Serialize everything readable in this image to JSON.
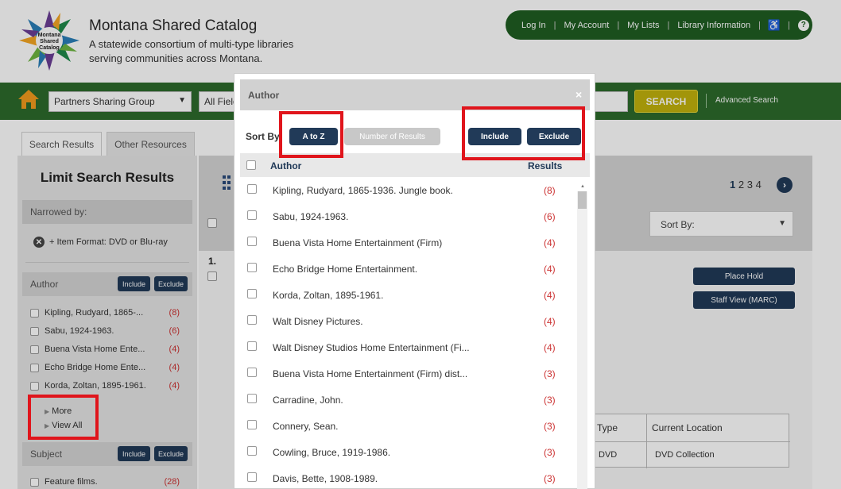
{
  "header": {
    "title": "Montana Shared Catalog",
    "subtitle": "A statewide consortium of multi-type libraries serving communities across Montana.",
    "logo_text": "Montana Shared Catalog",
    "nav": [
      "Log In",
      "My Account",
      "My Lists",
      "Library Information"
    ],
    "help": "?"
  },
  "search": {
    "group": "Partners Sharing Group",
    "field": "All Fields",
    "button": "SEARCH",
    "advanced": "Advanced Search"
  },
  "tabs": [
    "Search Results",
    "Other Resources"
  ],
  "sidebar": {
    "title": "Limit Search Results",
    "narrowed_label": "Narrowed by:",
    "active_filter": "+ Item Format: DVD or Blu-ray",
    "author_facet": {
      "label": "Author",
      "include": "Include",
      "exclude": "Exclude",
      "items": [
        {
          "name": "Kipling, Rudyard, 1865-...",
          "count": "(8)"
        },
        {
          "name": "Sabu, 1924-1963.",
          "count": "(6)"
        },
        {
          "name": "Buena Vista Home Ente...",
          "count": "(4)"
        },
        {
          "name": "Echo Bridge Home Ente...",
          "count": "(4)"
        },
        {
          "name": "Korda, Zoltan, 1895-1961.",
          "count": "(4)"
        }
      ],
      "more": "More",
      "view_all": "View All"
    },
    "subject_facet": {
      "label": "Subject",
      "include": "Include",
      "exclude": "Exclude",
      "items": [
        {
          "name": "Feature films.",
          "count": "(28)"
        }
      ]
    }
  },
  "results": {
    "pages": [
      "1",
      "2",
      "3",
      "4"
    ],
    "next": "›",
    "sort_label": "Sort By:",
    "first_number": "1.",
    "place_hold": "Place Hold",
    "staff_view": "Staff View (MARC)",
    "holdings_headers": [
      "Type",
      "Current Location"
    ],
    "holdings_row": [
      "DVD",
      "DVD Collection"
    ]
  },
  "modal": {
    "title": "Author",
    "close": "×",
    "sort_by": "Sort By",
    "sort_az": "A to Z",
    "sort_count": "Number of Results",
    "include": "Include",
    "exclude": "Exclude",
    "col_author": "Author",
    "col_results": "Results",
    "items": [
      {
        "name": "Kipling, Rudyard, 1865-1936. Jungle book.",
        "count": "(8)"
      },
      {
        "name": "Sabu, 1924-1963.",
        "count": "(6)"
      },
      {
        "name": "Buena Vista Home Entertainment (Firm)",
        "count": "(4)"
      },
      {
        "name": "Echo Bridge Home Entertainment.",
        "count": "(4)"
      },
      {
        "name": "Korda, Zoltan, 1895-1961.",
        "count": "(4)"
      },
      {
        "name": "Walt Disney Pictures.",
        "count": "(4)"
      },
      {
        "name": "Walt Disney Studios Home Entertainment (Fi...",
        "count": "(4)"
      },
      {
        "name": "Buena Vista Home Entertainment (Firm) dist...",
        "count": "(3)"
      },
      {
        "name": "Carradine, John.",
        "count": "(3)"
      },
      {
        "name": "Connery, Sean.",
        "count": "(3)"
      },
      {
        "name": "Cowling, Bruce, 1919-1986.",
        "count": "(3)"
      },
      {
        "name": "Davis, Bette, 1908-1989.",
        "count": "(3)"
      }
    ]
  },
  "colors": {
    "brand_green": "#2d6a2b",
    "nav_green": "#1f5e22",
    "button_navy": "#213a58",
    "search_gold": "#c2b20c",
    "count_red": "#cc3333",
    "highlight_red": "#e0151c"
  }
}
